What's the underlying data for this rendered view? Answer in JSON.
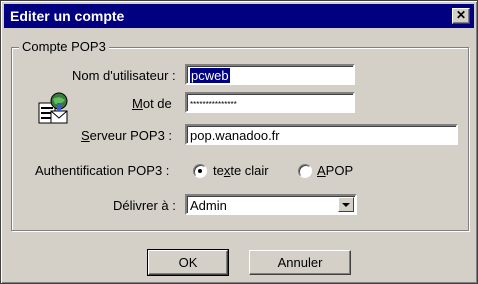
{
  "window": {
    "title": "Editer un compte",
    "close_glyph": "✕"
  },
  "group": {
    "legend": "Compte POP3"
  },
  "form": {
    "username_label": "Nom d'utilisateur :",
    "username_value": "pcweb",
    "password_label": "Mot de",
    "password_value": "***************",
    "server_label_u": "S",
    "server_label_rest": "erveur POP3 :",
    "server_value": "pop.wanadoo.fr",
    "auth_label": "Authentification POP3 :",
    "auth_option1_pre": "te",
    "auth_option1_u": "x",
    "auth_option1_post": "te clair",
    "auth_option2_u": "A",
    "auth_option2_rest": "POP",
    "auth_selected": "texte clair",
    "deliver_label": "Délivrer à :",
    "deliver_value": "Admin"
  },
  "buttons": {
    "ok": "OK",
    "cancel": "Annuler"
  },
  "icons": {
    "account": "account-mail-icon",
    "close": "close-icon",
    "dropdown": "chevron-down-icon"
  },
  "colors": {
    "titlebar": "#000080",
    "face": "#d4d0c8",
    "selection": "#000080"
  }
}
